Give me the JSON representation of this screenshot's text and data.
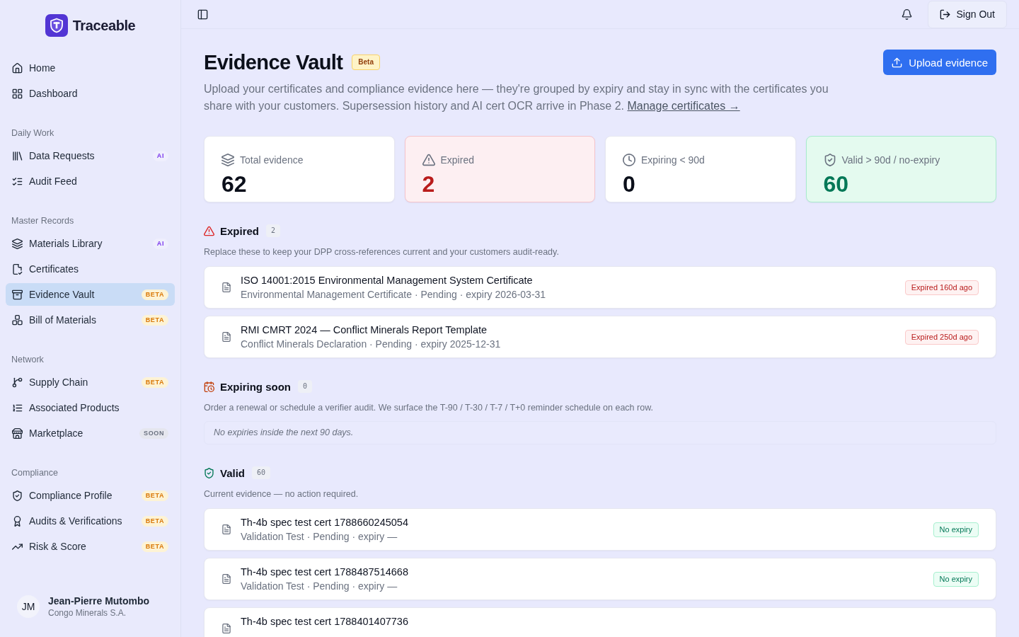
{
  "sidebar": {
    "brand": "Traceable",
    "sections": [
      {
        "items": [
          {
            "label": "Home",
            "selected": false
          },
          {
            "label": "Dashboard",
            "selected": false
          }
        ]
      },
      {
        "title": "Daily Work",
        "items": [
          {
            "label": "Data Requests",
            "selected": false,
            "badge": {
              "kind": "ai",
              "text": "AI"
            }
          },
          {
            "label": "Audit Feed",
            "selected": false
          }
        ]
      },
      {
        "title": "Master Records",
        "items": [
          {
            "label": "Materials Library",
            "selected": false,
            "badge": {
              "kind": "ai",
              "text": "AI"
            }
          },
          {
            "label": "Certificates",
            "selected": false
          },
          {
            "label": "Evidence Vault",
            "selected": true,
            "badge": {
              "kind": "beta",
              "text": "BETA"
            }
          },
          {
            "label": "Bill of Materials",
            "selected": false,
            "badge": {
              "kind": "beta",
              "text": "BETA"
            }
          }
        ]
      },
      {
        "title": "Network",
        "items": [
          {
            "label": "Supply Chain",
            "selected": false,
            "badge": {
              "kind": "beta",
              "text": "BETA"
            }
          },
          {
            "label": "Associated Products",
            "selected": false
          },
          {
            "label": "Marketplace",
            "selected": false,
            "badge": {
              "kind": "soon",
              "text": "SOON"
            }
          }
        ]
      },
      {
        "title": "Compliance",
        "items": [
          {
            "label": "Compliance Profile",
            "selected": false,
            "badge": {
              "kind": "beta",
              "text": "BETA"
            }
          },
          {
            "label": "Audits & Verifications",
            "selected": false,
            "badge": {
              "kind": "beta",
              "text": "BETA"
            }
          },
          {
            "label": "Risk & Score",
            "selected": false,
            "badge": {
              "kind": "beta",
              "text": "BETA"
            }
          }
        ]
      }
    ],
    "user": {
      "initials": "JM",
      "name": "Jean-Pierre Mutombo",
      "organization": "Congo Minerals S.A."
    }
  },
  "topbar": {
    "sign_out": "Sign Out"
  },
  "header": {
    "title": "Evidence Vault",
    "badge": "Beta",
    "description": "Upload your certificates and compliance evidence here — they're grouped by expiry and stay in sync with the certificates you share with your customers. Supersession history and AI cert OCR arrive in Phase 2.",
    "link": "Manage certificates →",
    "upload_button": "Upload evidence"
  },
  "stats": [
    {
      "kind": "total",
      "label": "Total evidence",
      "value": "62"
    },
    {
      "kind": "expired",
      "label": "Expired",
      "value": "2"
    },
    {
      "kind": "expiring",
      "label": "Expiring < 90d",
      "value": "0"
    },
    {
      "kind": "valid",
      "label": "Valid > 90d / no-expiry",
      "value": "60"
    }
  ],
  "sections": [
    {
      "kind": "expired",
      "title": "Expired",
      "count": "2",
      "description": "Replace these to keep your DPP cross-references current and your customers audit-ready.",
      "rows": [
        {
          "title": "ISO 14001:2015 Environmental Management System Certificate",
          "subtitle": "Environmental Management Certificate · Pending · expiry 2026-03-31",
          "badge": "Expired 160d ago"
        },
        {
          "title": "RMI CMRT 2024 — Conflict Minerals Report Template",
          "subtitle": "Conflict Minerals Declaration · Pending · expiry 2025-12-31",
          "badge": "Expired 250d ago"
        }
      ]
    },
    {
      "kind": "expiring",
      "title": "Expiring soon",
      "count": "0",
      "description": "Order a renewal or schedule a verifier audit. We surface the T-90 / T-30 / T-7 / T+0 reminder schedule on each row.",
      "empty_message": "No expiries inside the next 90 days."
    },
    {
      "kind": "valid",
      "title": "Valid",
      "count": "60",
      "description": "Current evidence — no action required.",
      "rows": [
        {
          "title": "Th-4b spec test cert 1788660245054",
          "subtitle": "Validation Test · Pending · expiry —",
          "badge": "No expiry"
        },
        {
          "title": "Th-4b spec test cert 1788487514668",
          "subtitle": "Validation Test · Pending · expiry —",
          "badge": "No expiry"
        },
        {
          "title": "Th-4b spec test cert 1788401407736"
        }
      ]
    }
  ]
}
